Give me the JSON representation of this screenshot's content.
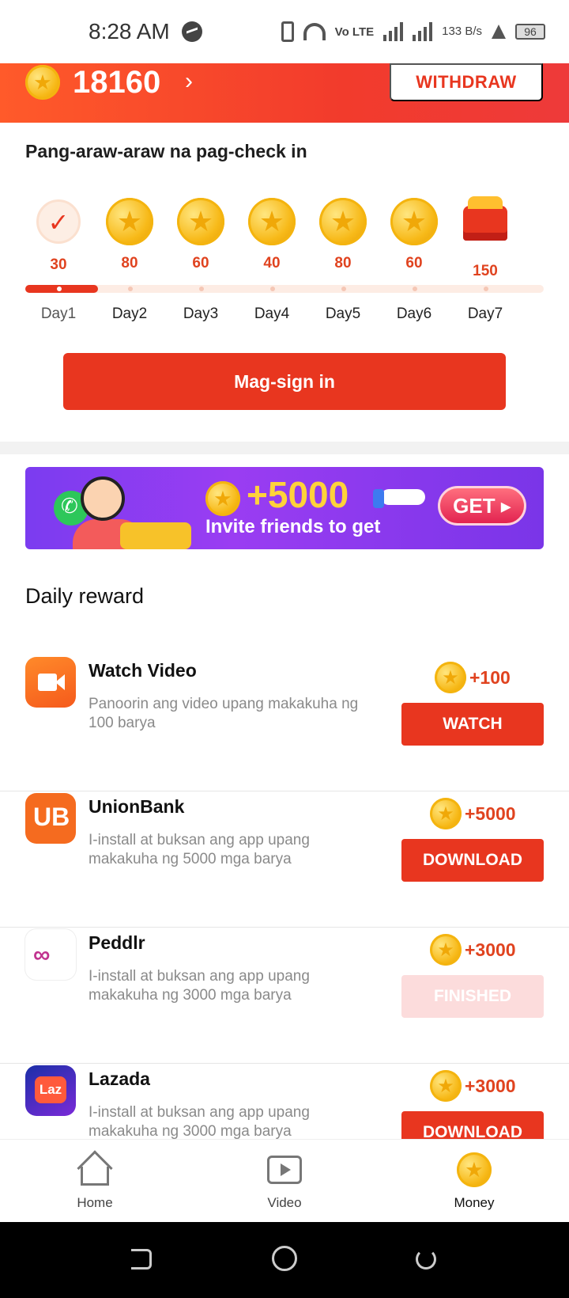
{
  "status_bar": {
    "time": "8:28 AM",
    "volte": "Vo LTE",
    "speed": "133 B/s",
    "battery": "96"
  },
  "header": {
    "balance": "18160",
    "withdraw_label": "WITHDRAW"
  },
  "checkin": {
    "title": "Pang-araw-araw na pag-check in",
    "days": [
      {
        "label": "Day1",
        "amount": "30",
        "status": "checked"
      },
      {
        "label": "Day2",
        "amount": "80",
        "status": "coin"
      },
      {
        "label": "Day3",
        "amount": "60",
        "status": "coin"
      },
      {
        "label": "Day4",
        "amount": "40",
        "status": "coin"
      },
      {
        "label": "Day5",
        "amount": "80",
        "status": "coin"
      },
      {
        "label": "Day6",
        "amount": "60",
        "status": "coin"
      },
      {
        "label": "Day7",
        "amount": "150",
        "status": "chest"
      }
    ],
    "signin_label": "Mag-sign in"
  },
  "banner": {
    "amount": "+5000",
    "subtitle": "Invite friends to get",
    "cta": "GET ▸"
  },
  "daily_reward": {
    "title": "Daily reward",
    "tasks": [
      {
        "name": "Watch Video",
        "desc": "Panoorin ang video upang makakuha ng 100 barya",
        "reward": "+100",
        "action": "WATCH",
        "icon": "video-camera-icon",
        "state": "active"
      },
      {
        "name": "UnionBank",
        "desc": "I-install at buksan ang app upang makakuha ng 5000 mga barya",
        "reward": "+5000",
        "action": "DOWNLOAD",
        "icon": "unionbank-logo-icon",
        "state": "active"
      },
      {
        "name": "Peddlr",
        "desc": "I-install at buksan ang app upang makakuha ng 3000 mga barya",
        "reward": "+3000",
        "action": "FINISHED",
        "icon": "peddlr-logo-icon",
        "state": "finished"
      },
      {
        "name": "Lazada",
        "desc": "I-install at buksan ang app upang makakuha ng 3000 mga barya",
        "reward": "+3000",
        "action": "DOWNLOAD",
        "icon": "lazada-logo-icon",
        "state": "active"
      }
    ]
  },
  "bottom_nav": {
    "items": [
      {
        "label": "Home",
        "icon": "home-icon",
        "active": false
      },
      {
        "label": "Video",
        "icon": "video-play-icon",
        "active": false
      },
      {
        "label": "Money",
        "icon": "coin-icon",
        "active": true
      }
    ]
  },
  "colors": {
    "accent": "#e8361f",
    "header_gradient_start": "#ff5a2a",
    "reward_text": "#e0431f",
    "banner_purple": "#7b3cf0"
  }
}
